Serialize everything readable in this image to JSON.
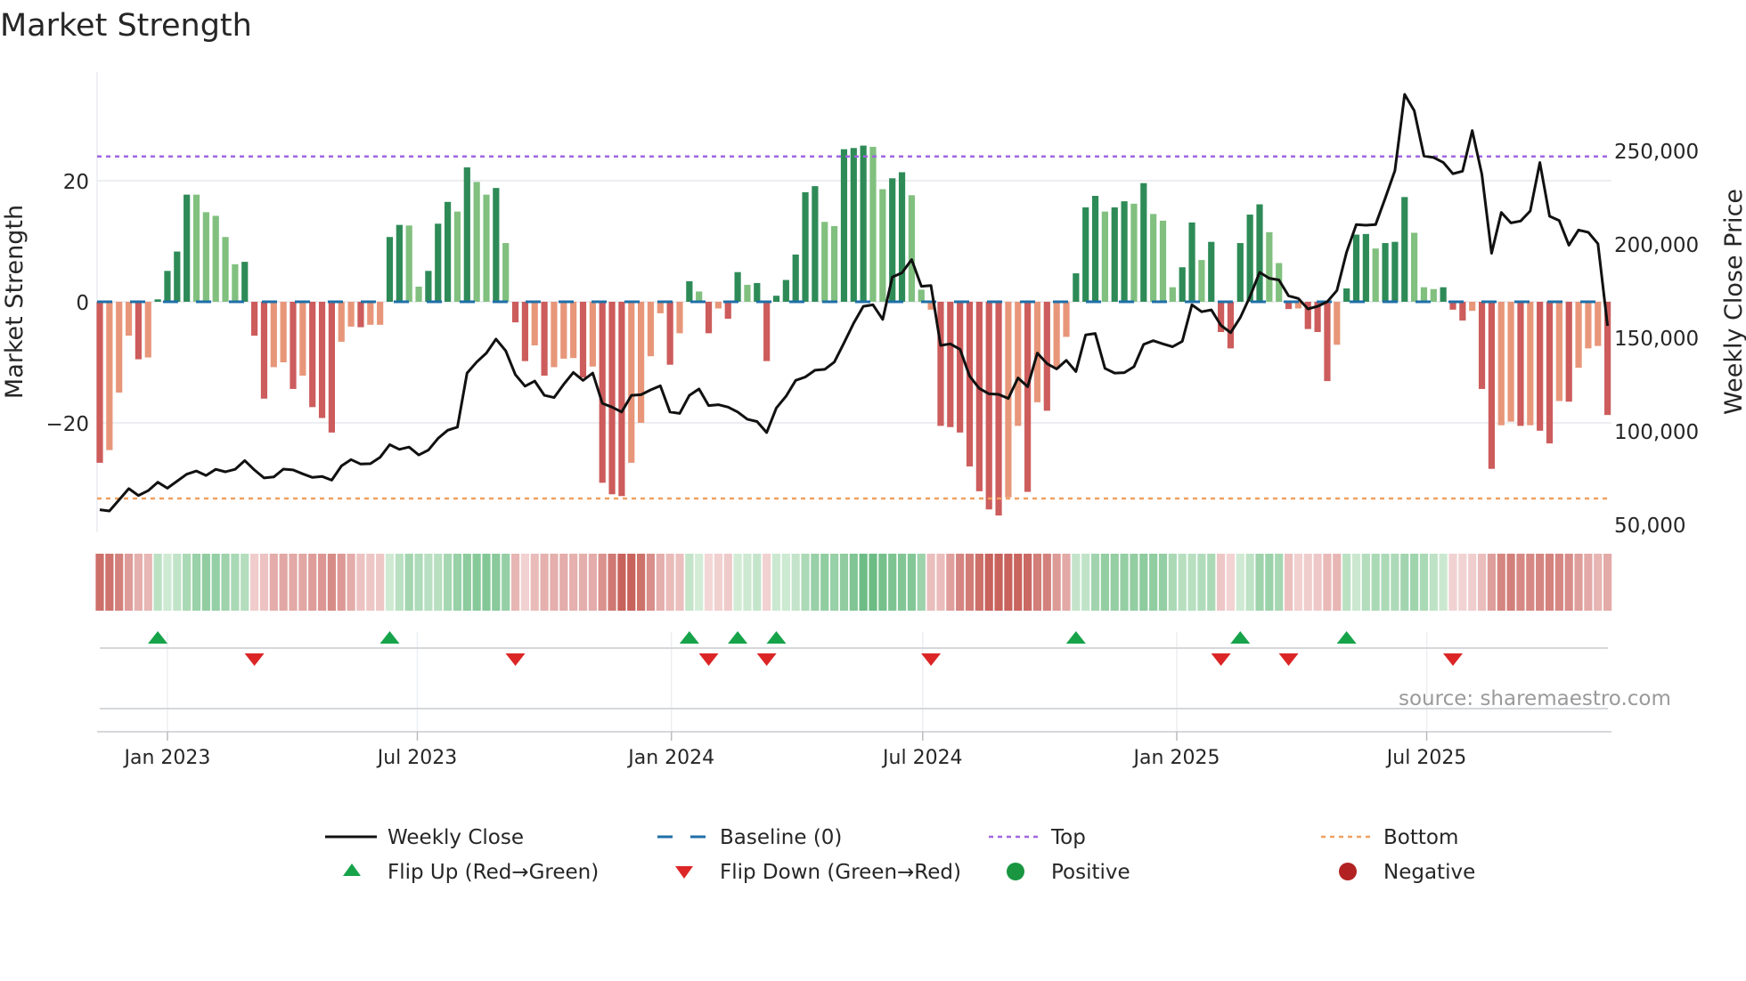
{
  "title": "Market Strength",
  "source": "source: sharemaestro.com",
  "legend": {
    "weekly_close": "Weekly Close",
    "baseline": "Baseline (0)",
    "top": "Top",
    "bottom": "Bottom",
    "flip_up": "Flip Up (Red→Green)",
    "flip_down": "Flip Down (Green→Red)",
    "positive": "Positive",
    "negative": "Negative"
  },
  "colors": {
    "strong_pos": "#2e8b57",
    "weak_pos": "#81c07f",
    "strong_neg": "#cd5c5c",
    "weak_neg": "#e8967a",
    "close": "#111111",
    "baseline": "#1f6fa8",
    "top": "#a066e0",
    "bottom": "#f0a060",
    "flip_up": "#16a34a",
    "flip_down": "#dc2626",
    "positive": "#1a9641",
    "negative": "#b22222"
  },
  "chart_data": {
    "type": "bar",
    "title": "Market Strength",
    "ylabel": "Market Strength",
    "y2label": "Weekly Close Price",
    "ylim": [
      -38,
      35
    ],
    "y2lim": [
      38000,
      285000
    ],
    "start_week": "2022-11-13",
    "frequency": "weekly",
    "top_level": 24,
    "bottom_level": -32.5,
    "yticks": [
      {
        "v": 20,
        "label": "20"
      },
      {
        "v": 0,
        "label": "0"
      },
      {
        "v": -20,
        "label": "−20"
      }
    ],
    "y2ticks": [
      {
        "v": 250000,
        "label": "250,000"
      },
      {
        "v": 200000,
        "label": "200,000"
      },
      {
        "v": 150000,
        "label": "150,000"
      },
      {
        "v": 100000,
        "label": "100,000"
      },
      {
        "v": 50000,
        "label": "50,000"
      }
    ],
    "xticks": [
      {
        "date": "2023-01-01",
        "label": "Jan 2023"
      },
      {
        "date": "2023-07-01",
        "label": "Jul 2023"
      },
      {
        "date": "2024-01-01",
        "label": "Jan 2024"
      },
      {
        "date": "2024-07-01",
        "label": "Jul 2024"
      },
      {
        "date": "2025-01-01",
        "label": "Jan 2025"
      },
      {
        "date": "2025-07-01",
        "label": "Jul 2025"
      }
    ],
    "strength": [
      -26.6,
      -24.5,
      -15,
      -5.6,
      -9.5,
      -9.2,
      0.4,
      5.1,
      8.3,
      17.7,
      17.7,
      14.8,
      14.2,
      10.7,
      6.2,
      6.6,
      -5.6,
      -16,
      -10.8,
      -10,
      -14.4,
      -12.2,
      -17.4,
      -19.2,
      -21.6,
      -6.6,
      -4.1,
      -4.2,
      -3.8,
      -3.8,
      10.7,
      12.7,
      12.6,
      2.5,
      5.1,
      12.9,
      16.5,
      14.9,
      22.2,
      19.8,
      17.7,
      18.8,
      9.7,
      -3.4,
      -9.8,
      -7.2,
      -12.2,
      -10.8,
      -9.4,
      -9.3,
      -12.5,
      -10.7,
      -29.9,
      -31.8,
      -32.1,
      -26.6,
      -20,
      -9,
      -1.9,
      -10.4,
      -5.2,
      3.4,
      1.7,
      -5.2,
      -1.1,
      -2.8,
      4.9,
      2.8,
      3.1,
      -9.8,
      1.0,
      3.6,
      7.8,
      18.1,
      19.1,
      13.2,
      12.5,
      25.2,
      25.4,
      25.8,
      25.6,
      18.6,
      20.4,
      21.4,
      17.6,
      2.0,
      -1.3,
      -20.5,
      -20.7,
      -21.6,
      -27.2,
      -31.3,
      -34.3,
      -35.3,
      -32.3,
      -20.5,
      -31.4,
      -16.6,
      -18,
      -11.1,
      -5.8,
      4.7,
      15.6,
      17.5,
      14.9,
      15.6,
      16.6,
      16.2,
      19.6,
      14.5,
      13.4,
      2.4,
      5.7,
      13.1,
      6.9,
      9.9,
      -5,
      -7.7,
      9.7,
      14.4,
      16.1,
      11.5,
      6.4,
      -1.2,
      -1.1,
      -4.5,
      -5,
      -13.1,
      -7.1,
      2.2,
      11.1,
      11.2,
      8.8,
      9.7,
      9.9,
      17.3,
      11.4,
      2.4,
      2.1,
      2.4,
      -1.3,
      -3.1,
      -1.5,
      -14.4,
      -27.6,
      -20.4,
      -19.8,
      -20.5,
      -20.4,
      -21.3,
      -23.4,
      -16.4,
      -16.5,
      -10.9,
      -7.7,
      -7.3,
      -18.7
    ],
    "shade": "DLLLDLDDDDLLLLLDDDLLDLDDDLLDLLDDLLDDDLDLLDLDDLDLLLDLDDDLLLLDLDLDLDDLDDDDDDDLLDDDLLDDLLLDDDDDDDLLDLDLLDDDLDDLDLLLDDLDDDDDDLLDLDDDLDDDLDDDLLLDDDLDDLLDLDDLDLLLD",
    "weekly_close": [
      57700,
      57000,
      63000,
      69000,
      65300,
      67900,
      72400,
      69200,
      73000,
      76700,
      78400,
      76000,
      79300,
      78000,
      79300,
      84000,
      79000,
      74700,
      75200,
      79400,
      79000,
      76900,
      75000,
      75500,
      73500,
      81100,
      84500,
      82100,
      82300,
      85700,
      92500,
      90000,
      91200,
      87000,
      89600,
      95900,
      100200,
      101900,
      130800,
      136700,
      141500,
      149000,
      142700,
      130000,
      123800,
      126500,
      118900,
      117700,
      124800,
      131100,
      126900,
      130800,
      114600,
      112600,
      110000,
      118900,
      119200,
      121800,
      124000,
      110000,
      109200,
      118900,
      122300,
      113400,
      113900,
      112600,
      110000,
      106100,
      104900,
      99000,
      112100,
      118400,
      126900,
      128700,
      132300,
      132800,
      136700,
      146900,
      157500,
      166500,
      167300,
      159500,
      182100,
      184400,
      191500,
      177200,
      177600,
      145600,
      146400,
      143500,
      129100,
      122600,
      119700,
      119400,
      117200,
      128200,
      123500,
      141500,
      135900,
      133000,
      137600,
      131600,
      151200,
      152000,
      133300,
      130800,
      131000,
      134200,
      146100,
      148100,
      146400,
      144900,
      147800,
      167300,
      163600,
      164600,
      156300,
      152400,
      160500,
      171600,
      184700,
      181500,
      180600,
      172100,
      170700,
      165100,
      166500,
      169000,
      175000,
      195400,
      210200,
      209900,
      210200,
      224300,
      239100,
      279900,
      271100,
      246900,
      246100,
      243500,
      237400,
      238800,
      260500,
      237100,
      194900,
      216700,
      211100,
      212100,
      217500,
      243400,
      214700,
      212400,
      199200,
      207300,
      206100,
      200000,
      156000
    ],
    "flip_up_weeks": [
      7,
      31,
      62,
      67,
      71,
      102,
      119,
      130
    ],
    "flip_down_weeks": [
      17,
      44,
      64,
      70,
      87,
      117,
      124,
      141
    ]
  }
}
